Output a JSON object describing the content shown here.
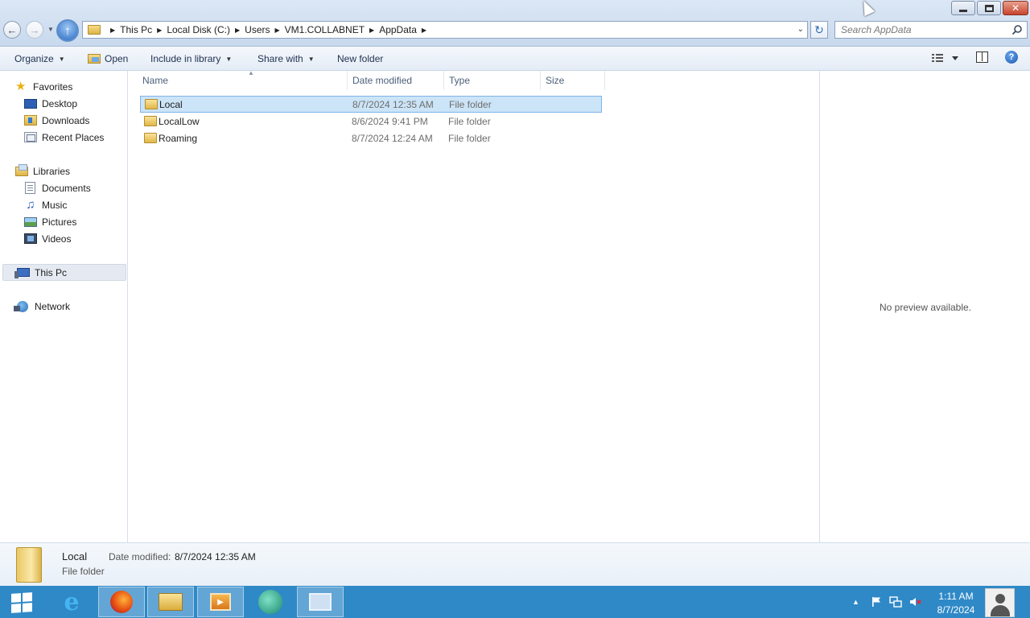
{
  "window": {
    "controls": [
      "minimize",
      "restore",
      "close"
    ],
    "close_glyph": "✕"
  },
  "address_bar": {
    "crumbs": [
      "This Pc",
      "Local Disk (C:)",
      "Users",
      "VM1.COLLABNET",
      "AppData"
    ]
  },
  "search": {
    "placeholder": "Search AppData"
  },
  "command_bar": {
    "organize": "Organize",
    "open": "Open",
    "include_in_library": "Include in library",
    "share_with": "Share with",
    "new_folder": "New folder"
  },
  "nav": {
    "favorites": "Favorites",
    "desktop": "Desktop",
    "downloads": "Downloads",
    "recent_places": "Recent Places",
    "libraries": "Libraries",
    "documents": "Documents",
    "music": "Music",
    "pictures": "Pictures",
    "videos": "Videos",
    "this_pc": "This Pc",
    "network": "Network"
  },
  "columns": {
    "name": "Name",
    "date_modified": "Date modified",
    "type": "Type",
    "size": "Size"
  },
  "files": [
    {
      "name": "Local",
      "date": "8/7/2024 12:35 AM",
      "type": "File folder",
      "selected": true
    },
    {
      "name": "LocalLow",
      "date": "8/6/2024 9:41 PM",
      "type": "File folder",
      "selected": false
    },
    {
      "name": "Roaming",
      "date": "8/7/2024 12:24 AM",
      "type": "File folder",
      "selected": false
    }
  ],
  "preview": {
    "text": "No preview available."
  },
  "details": {
    "name": "Local",
    "date_label": "Date modified:",
    "date_value": "8/7/2024 12:35 AM",
    "type": "File folder"
  },
  "taskbar": {
    "clock_time": "1:11 AM",
    "clock_date": "8/7/2024",
    "apps": [
      "internet-explorer",
      "firefox",
      "file-explorer",
      "media-player",
      "app-green",
      "server-manager"
    ]
  },
  "colors": {
    "taskbar": "#2f89c7",
    "selection": "#cce4f7",
    "selection_border": "#7eb4ea"
  }
}
